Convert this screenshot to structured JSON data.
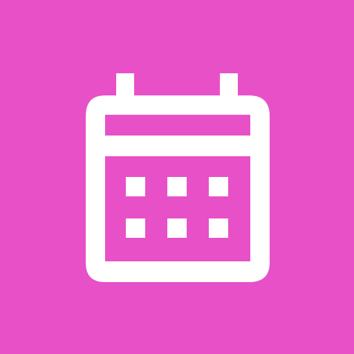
{
  "app_icon": {
    "icon": "calendar-icon",
    "background_color": "#E850C8",
    "glyph_color": "#FFFFFF"
  }
}
